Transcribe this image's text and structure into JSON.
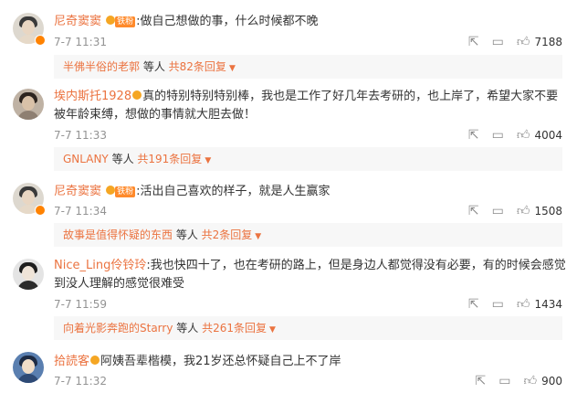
{
  "comments": [
    {
      "user": "尼奇窦窦",
      "fan_label": "铁粉",
      "text": ":做自己想做的事，什么时候都不晚",
      "time": "7-7 11:31",
      "likes": "7188",
      "reply": {
        "name": "半佛半俗的老郭",
        "mid": " 等人 ",
        "count": "共82条回复"
      }
    },
    {
      "user": "埃内斯托1928",
      "fan_label": "",
      "text": "真的特别特别特别棒，我也是工作了好几年去考研的，也上岸了，希望大家不要被年龄束缚，想做的事情就大胆去做！",
      "time": "7-7 11:33",
      "likes": "4004",
      "reply": {
        "name": "GNLANY",
        "mid": " 等人 ",
        "count": "共191条回复"
      }
    },
    {
      "user": "尼奇窦窦",
      "fan_label": "铁粉",
      "text": ":活出自己喜欢的样子，就是人生赢家",
      "time": "7-7 11:34",
      "likes": "1508",
      "reply": {
        "name": "故事是值得怀疑的东西",
        "mid": " 等人 ",
        "count": "共2条回复"
      }
    },
    {
      "user": "Nice_Ling伶铃玲",
      "fan_label": "",
      "text": ":我也快四十了，也在考研的路上，但是身边人都觉得没有必要，有的时候会感觉到没人理解的感觉很难受",
      "time": "7-7 11:59",
      "likes": "1434",
      "reply": {
        "name": "向着光影奔跑的Starry",
        "mid": " 等人 ",
        "count": "共261条回复"
      }
    },
    {
      "user": "拾読客",
      "fan_label": "",
      "text": "阿姨吾辈楷模，我21岁还总怀疑自己上不了岸",
      "time": "7-7 11:32",
      "likes": "900",
      "reply": null
    }
  ],
  "icons": {
    "share": "share-icon",
    "comment": "comment-icon",
    "like": "thumbs-up-icon",
    "caret": "caret-down-icon",
    "verified": "verified-badge-icon"
  },
  "colors": {
    "username": "#eb7340",
    "meta": "#939393",
    "reply_bg": "#f7f7f7",
    "badge": "#ff8200"
  }
}
